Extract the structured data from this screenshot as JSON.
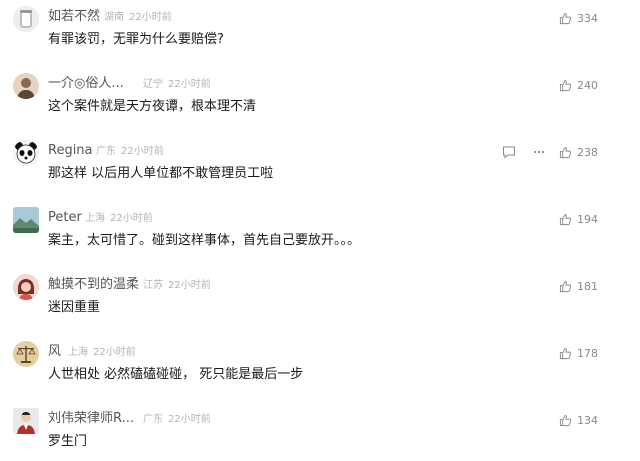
{
  "comments": [
    {
      "name": "如若不然",
      "location": "湖南",
      "time": "22小时前",
      "text": "有罪该罚，无罪为什么要赔偿?",
      "likes": "334",
      "avatar_icon": "jar-avatar-icon",
      "avatar_color": "#e9e9e9"
    },
    {
      "name": "一介◎俗人...",
      "location": "辽宁",
      "time": "22小时前",
      "text": "这个案件就是天方夜谭，根本理不清",
      "likes": "240",
      "avatar_icon": "person-avatar-icon",
      "avatar_color": "#d9b89a"
    },
    {
      "name": "Regina",
      "location": "广东",
      "time": "22小时前",
      "text": "那这样 以后用人单位都不敢管理员工啦",
      "likes": "238",
      "avatar_icon": "panda-avatar-icon",
      "avatar_color": "#f2f2f2"
    },
    {
      "name": "Peter",
      "location": "上海",
      "time": "22小时前",
      "text": "案主，太可惜了。碰到这样事体，首先自己要放开。。。",
      "likes": "194",
      "avatar_icon": "landscape-avatar-icon",
      "avatar_color": "#8fb3a0"
    },
    {
      "name": "触摸不到的温柔",
      "location": "江苏",
      "time": "22小时前",
      "text": "迷因重重",
      "likes": "181",
      "avatar_icon": "girl-avatar-icon",
      "avatar_color": "#e8a89a"
    },
    {
      "name": "风",
      "location": "上海",
      "time": "22小时前",
      "text": "人世相处 必然磕磕碰碰， 死只能是最后一步",
      "likes": "178",
      "avatar_icon": "scales-avatar-icon",
      "avatar_color": "#c9a36a"
    },
    {
      "name": "刘伟荣律师R...",
      "location": "广东",
      "time": "22小时前",
      "text": "罗生门",
      "likes": "134",
      "avatar_icon": "lawyer-avatar-icon",
      "avatar_color": "#b44a3c"
    }
  ]
}
